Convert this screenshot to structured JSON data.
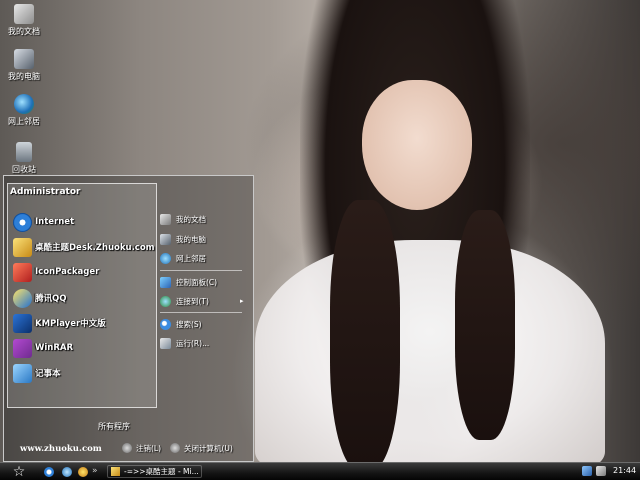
{
  "desktop": {
    "icons": [
      {
        "label": "我的文档",
        "icon": "my-documents-icon"
      },
      {
        "label": "我的电脑",
        "icon": "my-computer-icon"
      },
      {
        "label": "网上邻居",
        "icon": "network-places-icon"
      },
      {
        "label": "回收站",
        "icon": "recycle-bin-icon"
      }
    ]
  },
  "start_menu": {
    "user": "Administrator",
    "programs": [
      {
        "label": "Internet",
        "icon": "ie-icon"
      },
      {
        "label": "桌酷主题Desk.Zhuoku.com",
        "icon": "desktop-theme-icon"
      },
      {
        "label": "IconPackager",
        "icon": "iconpackager-icon"
      },
      {
        "label": "腾讯QQ",
        "icon": "qq-icon"
      },
      {
        "label": "KMPlayer中文版",
        "icon": "kmplayer-icon"
      },
      {
        "label": "WinRAR",
        "icon": "winrar-icon"
      },
      {
        "label": "记事本",
        "icon": "notepad-icon"
      }
    ],
    "all_programs": "所有程序",
    "website": "www.zhuoku.com",
    "places": [
      {
        "label": "我的文档",
        "icon": "documents-icon"
      },
      {
        "label": "我的电脑",
        "icon": "computer-icon"
      },
      {
        "label": "网上邻居",
        "icon": "network-icon"
      }
    ],
    "system": [
      {
        "label": "控制面板(C)",
        "icon": "control-panel-icon"
      },
      {
        "label": "连接到(T)",
        "icon": "connect-icon"
      }
    ],
    "tools": [
      {
        "label": "搜索(S)",
        "icon": "search-icon"
      },
      {
        "label": "运行(R)...",
        "icon": "run-icon"
      }
    ],
    "logoff": "注销(L)",
    "shutdown": "关闭计算机(U)"
  },
  "taskbar": {
    "start_glyph": "☆",
    "separator": "»",
    "task": "-=>>桌酷主题 - Mi...",
    "clock": "21:44"
  },
  "colors": {
    "taskbar": "#141414",
    "menu_border": "#c9c9c9"
  }
}
